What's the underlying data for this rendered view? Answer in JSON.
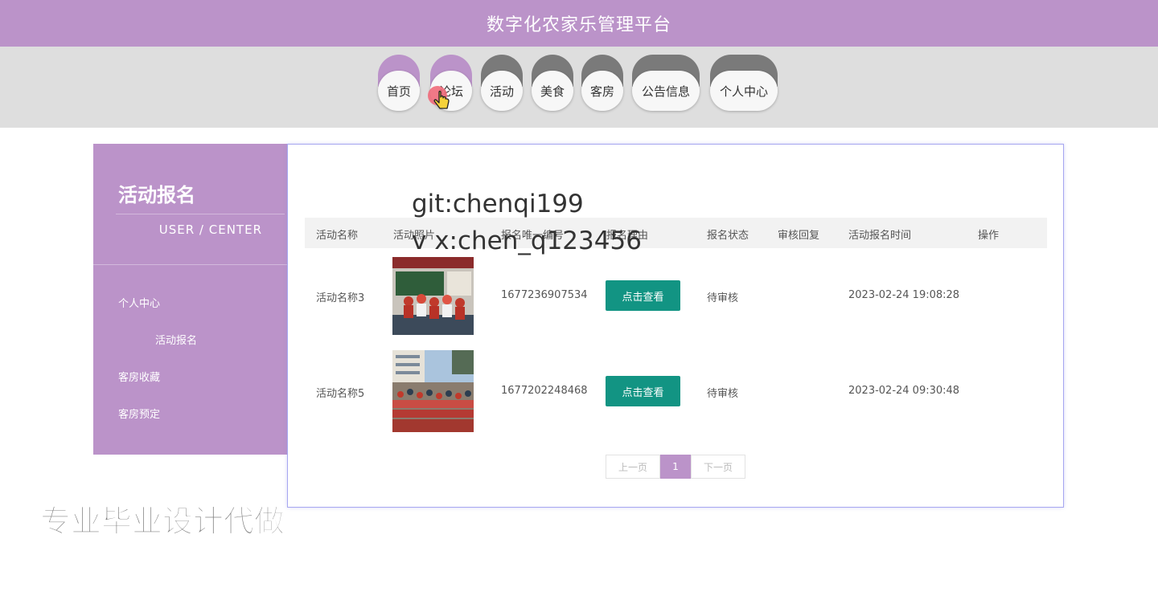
{
  "header": {
    "title": "数字化农家乐管理平台"
  },
  "nav": {
    "items": [
      {
        "label": "首页"
      },
      {
        "label": "论坛"
      },
      {
        "label": "活动"
      },
      {
        "label": "美食"
      },
      {
        "label": "客房"
      },
      {
        "label": "公告信息"
      },
      {
        "label": "个人中心"
      }
    ]
  },
  "sidebar": {
    "title": "活动报名",
    "subtitle": "USER / CENTER",
    "items": [
      {
        "label": "个人中心"
      },
      {
        "label": "活动报名"
      },
      {
        "label": "客房收藏"
      },
      {
        "label": "客房预定"
      }
    ]
  },
  "table": {
    "columns": [
      "活动名称",
      "活动照片",
      "报名唯一编号",
      "报名理由",
      "报名状态",
      "审核回复",
      "活动报名时间",
      "操作"
    ],
    "rows": [
      {
        "name": "活动名称3",
        "number": "1677236907534",
        "reason_button": "点击查看",
        "status": "待审核",
        "reply": "",
        "time": "2023-02-24 19:08:28"
      },
      {
        "name": "活动名称5",
        "number": "1677202248468",
        "reason_button": "点击查看",
        "status": "待审核",
        "reply": "",
        "time": "2023-02-24 09:30:48"
      }
    ]
  },
  "pagination": {
    "prev": "上一页",
    "current": "1",
    "next": "下一页"
  },
  "watermarks": {
    "git": "git:chenqi199",
    "vx": "v x:chen_q123456",
    "ad": "专业毕业设计代做"
  },
  "colors": {
    "brand": "#bb93c9",
    "button": "#129483",
    "nav_band": "#dedede",
    "cap_gray": "#7a7a7a"
  }
}
